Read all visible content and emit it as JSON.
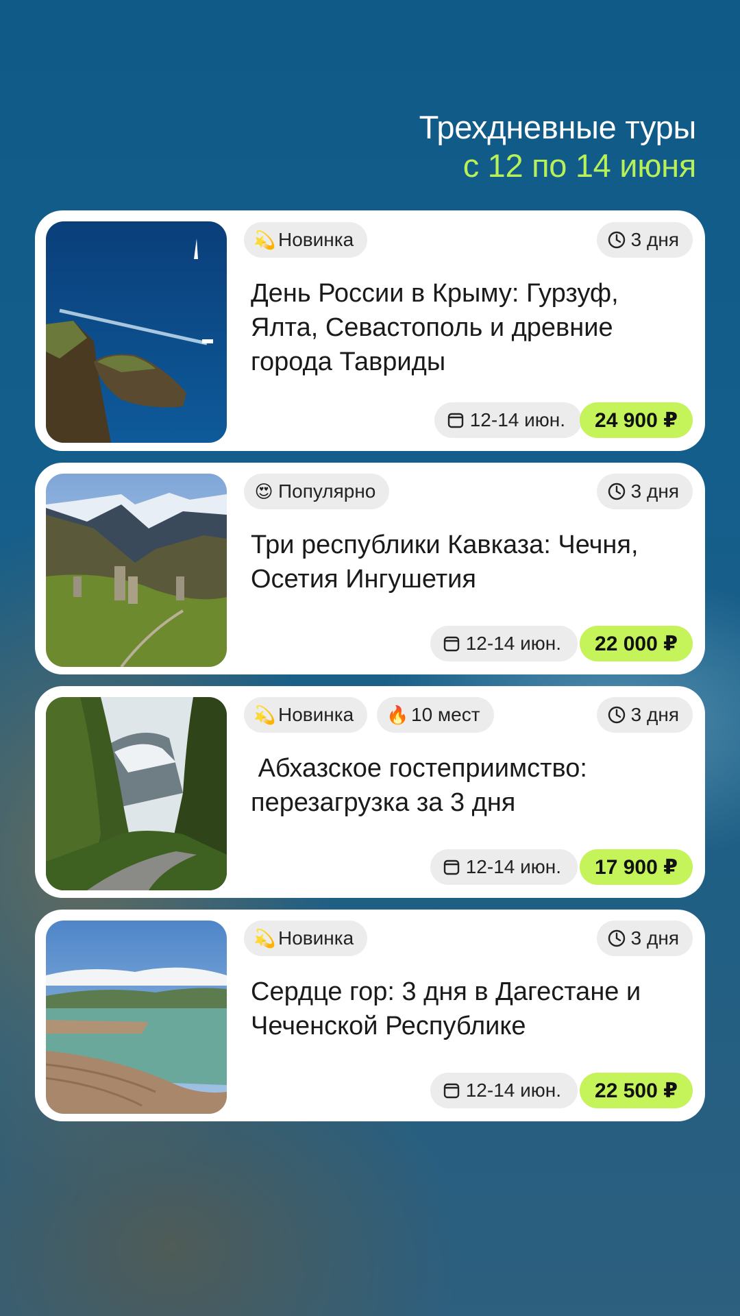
{
  "header": {
    "line1": "Трехдневные туры",
    "line2": "с 12 по 14 июня"
  },
  "colors": {
    "accent_green": "#c4f35a",
    "header_green": "#b8f05a",
    "pill_gray": "#ececec"
  },
  "tours": [
    {
      "badges": [
        {
          "icon": "dizzy-emoji-icon",
          "emoji": "💫",
          "label": "Новинка"
        }
      ],
      "duration": "3 дня",
      "title": "День России в Крыму: Гурзуф, Ялта, Севастополь и древние города Тавриды",
      "dates": "12-14 июн.",
      "price": "24 900 ₽",
      "image": "crimea-coast-photo"
    },
    {
      "badges": [
        {
          "icon": "heart-eyes-emoji-icon",
          "emoji": "😍",
          "label": "Популярно"
        }
      ],
      "duration": "3 дня",
      "title": "Три республики Кавказа: Чечня, Осетия Ингушетия",
      "dates": "12-14 июн.",
      "price": "22 000 ₽",
      "image": "caucasus-towers-photo"
    },
    {
      "badges": [
        {
          "icon": "dizzy-emoji-icon",
          "emoji": "💫",
          "label": "Новинка"
        },
        {
          "icon": "fire-emoji-icon",
          "emoji": "🔥",
          "label": "10 мест"
        }
      ],
      "duration": "3 дня",
      "title": " Абхазское гостеприимство: перезагрузка за 3 дня",
      "dates": "12-14 июн.",
      "price": "17 900 ₽",
      "image": "abkhazia-canyon-photo"
    },
    {
      "badges": [
        {
          "icon": "dizzy-emoji-icon",
          "emoji": "💫",
          "label": "Новинка"
        }
      ],
      "duration": "3 дня",
      "title": "Сердце гор: 3 дня в Дагестане и Чеченской Республике",
      "dates": "12-14 июн.",
      "price": "22 500 ₽",
      "image": "dagestan-lake-photo"
    }
  ]
}
